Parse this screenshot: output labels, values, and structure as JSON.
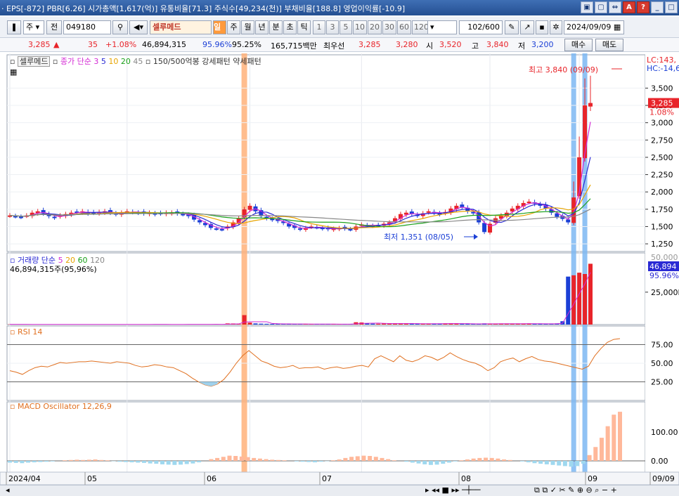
{
  "title_bar": {
    "text": "· EPS[-872]  PBR[6.26]  시가총액[1,617(억)]  유통비율[71.3]  주식수[49,234(천)]  부채비율[188.8]  영업이익률[-10.9]"
  },
  "toolbar": {
    "market": "주",
    "all": "전",
    "code": "049180",
    "name": "셀루메드",
    "periods": [
      "일",
      "주",
      "월",
      "년",
      "분",
      "초",
      "틱"
    ],
    "active_period": "일",
    "intervals": [
      "1",
      "3",
      "5",
      "10",
      "20",
      "30",
      "60",
      "120"
    ],
    "count": "102",
    "total": "/600",
    "date": "2024/09/09"
  },
  "quote": {
    "price": "3,285",
    "change": "35",
    "change_pct": "+1.08%",
    "volume": "46,894,315",
    "vol_ratio1": "95.96%",
    "vol_ratio2": "95.25%",
    "amount": "165,715백만",
    "priority_label": "최우선",
    "ask": "3,285",
    "bid": "3,280",
    "open_label": "시",
    "open": "3,520",
    "high_label": "고",
    "high": "3,840",
    "low_label": "저",
    "low": "3,200",
    "buy_button": "매수",
    "sell_button": "매도"
  },
  "price_panel": {
    "legend_name": "셀루메드",
    "legend_ma": "종가 단순",
    "ma_periods": [
      "3",
      "5",
      "10",
      "20",
      "45"
    ],
    "pattern_text": "150/500억봉 강세패턴  약세패턴",
    "high_marker": "최고 3,840 (09/09)",
    "low_marker": "최저 1,351 (08/05)",
    "lc_label": "LC:143,",
    "hc_label": "HC:-14,6",
    "current_price_tag": "3,285",
    "current_pct_tag": "1.08%",
    "y_ticks": [
      "3,500",
      "3,250",
      "3,000",
      "2,750",
      "2,500",
      "2,250",
      "2,000",
      "1,750",
      "1,500",
      "1,250"
    ]
  },
  "volume_panel": {
    "legend": "거래량 단순",
    "periods": [
      "5",
      "20",
      "60",
      "120"
    ],
    "value_text": "46,894,315주(95,96%)",
    "tag_value": "46,894",
    "tag_pct": "95.96%",
    "y_tick": "25,000K",
    "top_tick_partial": "50,000"
  },
  "rsi_panel": {
    "legend": "RSI 14",
    "y_ticks": [
      "75.00",
      "50.00",
      "25.00"
    ]
  },
  "macd_panel": {
    "legend": "MACD Oscillator 12,26,9",
    "y_ticks": [
      "100.00",
      "0.00"
    ]
  },
  "x_axis": {
    "labels": [
      "2024/04",
      "05",
      "06",
      "07",
      "08",
      "09",
      "09/09"
    ]
  },
  "colors": {
    "up": "#e8242a",
    "down": "#1b3fd6",
    "highlight_orange": "#ffb27a",
    "highlight_blue": "#7db7f2",
    "ma3": "#d42ad4",
    "ma5": "#2a2ad4",
    "ma10": "#e7a400",
    "ma20": "#1aa01a",
    "ma45": "#888888"
  },
  "chart_data": {
    "type": "candlestick",
    "title": "셀루메드",
    "close_daily": [
      1660,
      1650,
      1640,
      1660,
      1700,
      1720,
      1690,
      1650,
      1630,
      1660,
      1680,
      1700,
      1710,
      1720,
      1690,
      1700,
      1710,
      1720,
      1700,
      1680,
      1700,
      1720,
      1710,
      1700,
      1690,
      1700,
      1680,
      1690,
      1700,
      1700,
      1690,
      1680,
      1650,
      1600,
      1560,
      1520,
      1480,
      1470,
      1460,
      1500,
      1560,
      1620,
      1750,
      1800,
      1720,
      1650,
      1620,
      1600,
      1580,
      1550,
      1500,
      1480,
      1460,
      1480,
      1500,
      1490,
      1470,
      1460,
      1470,
      1480,
      1470,
      1460,
      1500,
      1530,
      1520,
      1510,
      1520,
      1540,
      1560,
      1620,
      1680,
      1700,
      1680,
      1660,
      1690,
      1720,
      1700,
      1680,
      1710,
      1760,
      1800,
      1780,
      1720,
      1690,
      1560,
      1420,
      1540,
      1620,
      1660,
      1700,
      1760,
      1800,
      1840,
      1860,
      1830,
      1800,
      1760,
      1700,
      1640,
      1610,
      1560,
      1920,
      2500,
      3250,
      3285
    ],
    "volume_k": [
      200,
      180,
      160,
      150,
      140,
      150,
      130,
      120,
      140,
      150,
      160,
      150,
      140,
      130,
      140,
      150,
      160,
      170,
      180,
      160,
      150,
      140,
      150,
      160,
      180,
      190,
      170,
      160,
      150,
      160,
      170,
      180,
      200,
      220,
      250,
      260,
      240,
      220,
      200,
      900,
      850,
      420,
      7300,
      1500,
      900,
      700,
      600,
      550,
      500,
      480,
      460,
      450,
      430,
      420,
      410,
      400,
      380,
      370,
      360,
      350,
      340,
      330,
      1800,
      1600,
      900,
      700,
      650,
      800,
      950,
      900,
      850,
      700,
      650,
      600,
      650,
      700,
      750,
      800,
      900,
      850,
      700,
      600,
      550,
      500,
      450,
      900,
      700,
      650,
      600,
      700,
      750,
      800,
      700,
      650,
      600,
      560,
      550,
      540,
      900,
      2600,
      37000,
      38000,
      40000,
      39000,
      46894
    ],
    "rsi": [
      40,
      38,
      35,
      40,
      44,
      46,
      45,
      48,
      51,
      50,
      51,
      52,
      52,
      53,
      52,
      51,
      50,
      52,
      51,
      50,
      47,
      45,
      46,
      48,
      47,
      45,
      44,
      40,
      36,
      30,
      25,
      21,
      19,
      22,
      28,
      38,
      50,
      60,
      67,
      60,
      53,
      50,
      46,
      44,
      45,
      47,
      43,
      44,
      44,
      45,
      42,
      44,
      45,
      43,
      44,
      46,
      47,
      45,
      56,
      60,
      56,
      52,
      60,
      54,
      52,
      55,
      60,
      58,
      54,
      58,
      64,
      59,
      55,
      52,
      50,
      46,
      40,
      44,
      52,
      55,
      57,
      52,
      56,
      59,
      55,
      53,
      52,
      50,
      48,
      46,
      44,
      42,
      46,
      60,
      70,
      78,
      82,
      83
    ],
    "macd_osc": [
      -6,
      -7,
      -8,
      -6,
      -5,
      -4,
      -3,
      -2,
      0,
      2,
      3,
      4,
      3,
      4,
      5,
      3,
      2,
      -1,
      -3,
      -4,
      -5,
      -6,
      -7,
      -9,
      -10,
      -12,
      -13,
      -14,
      -13,
      -11,
      -9,
      -5,
      0,
      6,
      10,
      14,
      18,
      17,
      15,
      13,
      10,
      8,
      6,
      4,
      3,
      2,
      0,
      -2,
      -3,
      -4,
      -5,
      -3,
      -1,
      2,
      5,
      10,
      14,
      16,
      18,
      17,
      14,
      10,
      6,
      2,
      0,
      -3,
      -6,
      -9,
      -12,
      -14,
      -13,
      -10,
      -6,
      -2,
      2,
      5,
      8,
      10,
      11,
      10,
      8,
      5,
      3,
      0,
      -2,
      -5,
      -8,
      -10,
      -12,
      -14,
      -16,
      -18,
      -20,
      -18,
      -10,
      20,
      48,
      80,
      120,
      160,
      170
    ],
    "y_range_price": [
      1250,
      3840
    ],
    "y_range_rsi": [
      0,
      100
    ],
    "x_labels": [
      "2024/04",
      "05",
      "06",
      "07",
      "08",
      "09",
      "09/09"
    ]
  }
}
